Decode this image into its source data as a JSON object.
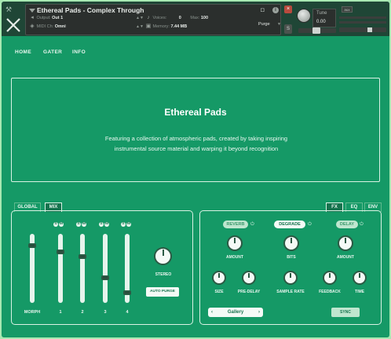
{
  "header": {
    "instrument_name": "Ethereal Pads - Complex Through",
    "output_label": "Output:",
    "output_value": "Out 1",
    "midi_label": "MIDI Ch:",
    "midi_value": "Omni",
    "voices_label": "Voices:",
    "voices_value": "0",
    "max_label": "Max:",
    "max_value": "100",
    "memory_label": "Memory:",
    "memory_value": "7.44 MB",
    "purge_label": "Purge",
    "close_glyph": "×",
    "solo_glyph": "S",
    "tune_label": "Tune",
    "tune_value": "0.00",
    "aux_label": "aux",
    "icons": [
      "wrench-icon",
      "x-logo-icon",
      "camera-icon",
      "info-icon",
      "close-icon"
    ]
  },
  "nav": {
    "items": [
      "HOME",
      "GATER",
      "INFO"
    ]
  },
  "hero": {
    "title": "Ethereal Pads",
    "desc_line1": "Featuring a collection of atmospheric pads, created by taking inspiring",
    "desc_line2": "instrumental source material and warping it beyond recognition"
  },
  "tabs_left": [
    "GLOBAL",
    "MIX"
  ],
  "tabs_right": [
    "FX",
    "EQ",
    "ENV"
  ],
  "mixer": {
    "channels": [
      {
        "label": "MORPH",
        "level": 0.85
      },
      {
        "label": "1",
        "level": 0.76
      },
      {
        "label": "2",
        "level": 0.68
      },
      {
        "label": "3",
        "level": 0.35
      },
      {
        "label": "4",
        "level": 0.12
      }
    ],
    "solo_glyph": "S",
    "mute_glyph": "M",
    "stereo_label": "STEREO",
    "autopurge_label": "AUTO PURGE"
  },
  "fx": {
    "modules": [
      {
        "name": "REVERB",
        "state": "off"
      },
      {
        "name": "DEGRADE",
        "state": "on"
      },
      {
        "name": "DELAY",
        "state": "off"
      }
    ],
    "top_knobs": [
      "AMOUNT",
      "BITS",
      "AMOUNT"
    ],
    "bottom_knobs": [
      "SIZE",
      "PRE-DELAY",
      "SAMPLE RATE",
      "FEEDBACK",
      "TIME"
    ],
    "preset_value": "Gallery",
    "preset_prev": "‹",
    "preset_next": "›",
    "sync_label": "SYNC"
  },
  "colors": {
    "background": "#159966",
    "panel_border": "#d9f2e4",
    "knob_fill": "#f4faf6",
    "header_bg": "#1f4636"
  }
}
